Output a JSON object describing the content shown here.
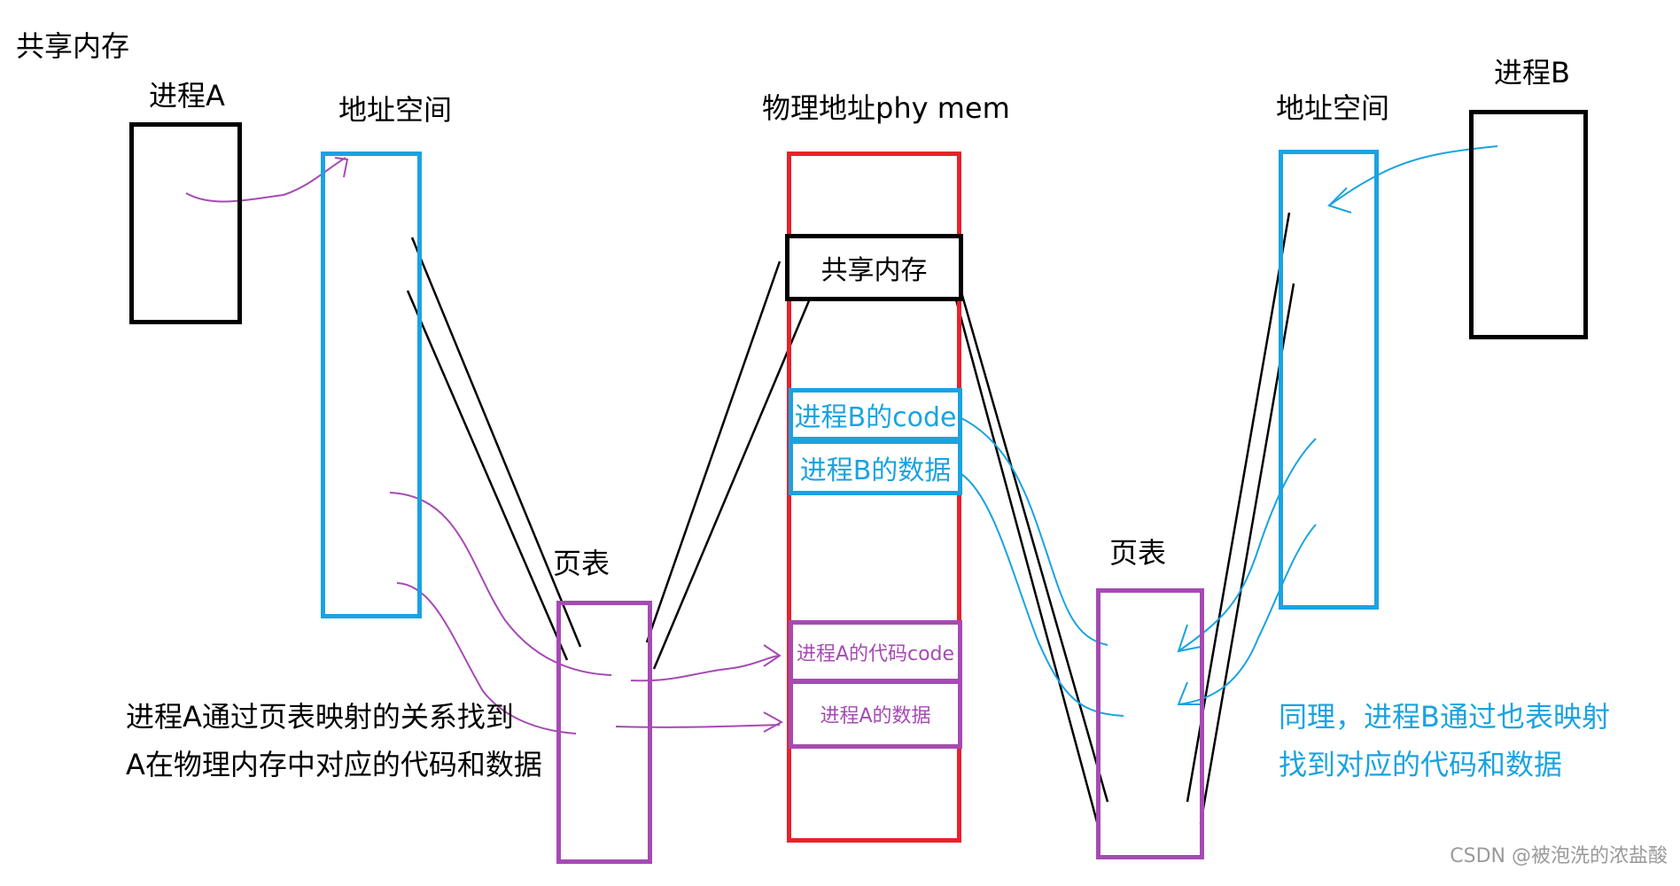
{
  "title": "共享内存",
  "process_a": {
    "label": "进程A"
  },
  "process_b": {
    "label": "进程B"
  },
  "addr_space_a": {
    "label": "地址空间"
  },
  "addr_space_b": {
    "label": "地址空间"
  },
  "phys_mem": {
    "label": "物理地址phy mem",
    "shared_block": "共享内存",
    "b_code": "进程B的code",
    "b_data": "进程B的数据",
    "a_code": "进程A的代码code",
    "a_data": "进程A的数据"
  },
  "page_table_a": {
    "label": "页表"
  },
  "page_table_b": {
    "label": "页表"
  },
  "note_a": [
    "进程A通过页表映射的关系找到",
    "A在物理内存中对应的代码和数据"
  ],
  "note_b": [
    "同理，进程B通过也表映射",
    "找到对应的代码和数据"
  ],
  "watermark": "CSDN @被泡洗的浓盐酸",
  "colors": {
    "black": "#000000",
    "blue": "#1aa3e0",
    "red": "#e8222a",
    "purple": "#a64ab4"
  }
}
